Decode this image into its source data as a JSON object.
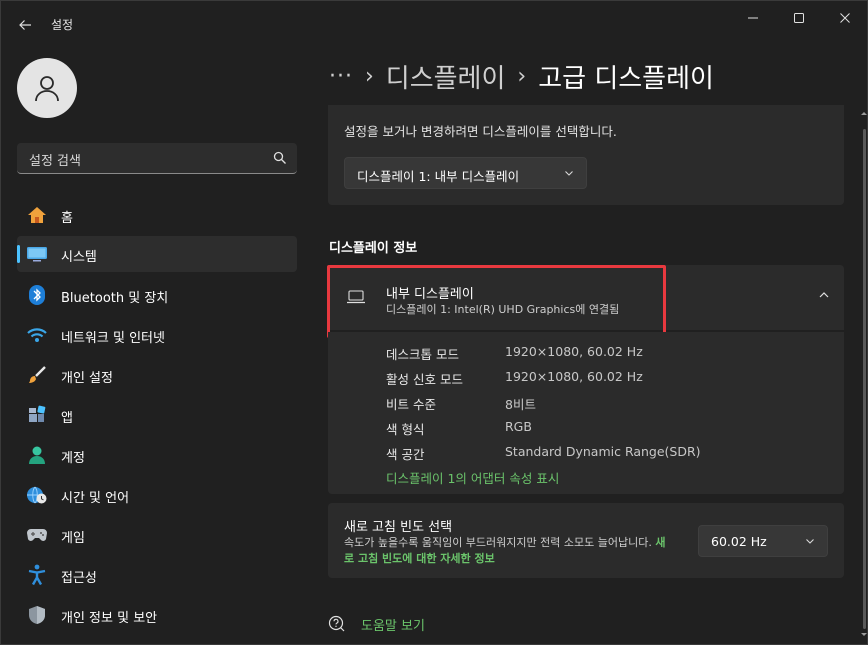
{
  "app": {
    "title": "설정"
  },
  "sidebar": {
    "search_placeholder": "설정 검색",
    "items": [
      {
        "label": "홈",
        "icon": "home-icon"
      },
      {
        "label": "시스템",
        "icon": "system-icon",
        "selected": true
      },
      {
        "label": "Bluetooth 및 장치",
        "icon": "bluetooth-icon"
      },
      {
        "label": "네트워크 및 인터넷",
        "icon": "wifi-icon"
      },
      {
        "label": "개인 설정",
        "icon": "brush-icon"
      },
      {
        "label": "앱",
        "icon": "apps-icon"
      },
      {
        "label": "계정",
        "icon": "account-icon"
      },
      {
        "label": "시간 및 언어",
        "icon": "globe-clock-icon"
      },
      {
        "label": "게임",
        "icon": "gamepad-icon"
      },
      {
        "label": "접근성",
        "icon": "accessibility-icon"
      },
      {
        "label": "개인 정보 및 보안",
        "icon": "shield-icon"
      }
    ]
  },
  "breadcrumb": {
    "more": "···",
    "parent": "디스플레이",
    "current": "고급 디스플레이"
  },
  "display_select": {
    "description": "설정을 보거나 변경하려면 디스플레이를 선택합니다.",
    "value": "디스플레이 1: 내부 디스플레이"
  },
  "display_info": {
    "section_title": "디스플레이 정보",
    "title": "내부 디스플레이",
    "subtitle": "디스플레이 1: Intel(R) UHD Graphics에 연결됨",
    "properties": [
      {
        "label": "데스크톱 모드",
        "value": "1920×1080, 60.02 Hz"
      },
      {
        "label": "활성 신호 모드",
        "value": "1920×1080, 60.02 Hz"
      },
      {
        "label": "비트 수준",
        "value": "8비트"
      },
      {
        "label": "색 형식",
        "value": "RGB"
      },
      {
        "label": "색 공간",
        "value": "Standard Dynamic Range(SDR)"
      }
    ],
    "adapter_link": "디스플레이 1의 어댑터 속성 표시"
  },
  "refresh_rate": {
    "title": "새로 고침 빈도 선택",
    "description": "속도가 높을수록 움직임이 부드러워지지만 전력 소모도 늘어납니다.",
    "link": "새로 고침 빈도에 대한 자세한 정보",
    "value": "60.02 Hz"
  },
  "help": {
    "label": "도움말 보기"
  },
  "colors": {
    "accent": "#4cc2ff",
    "link": "#6bc46b",
    "highlight": "#e8393f",
    "card": "#2b2b2b",
    "background": "#202020"
  }
}
